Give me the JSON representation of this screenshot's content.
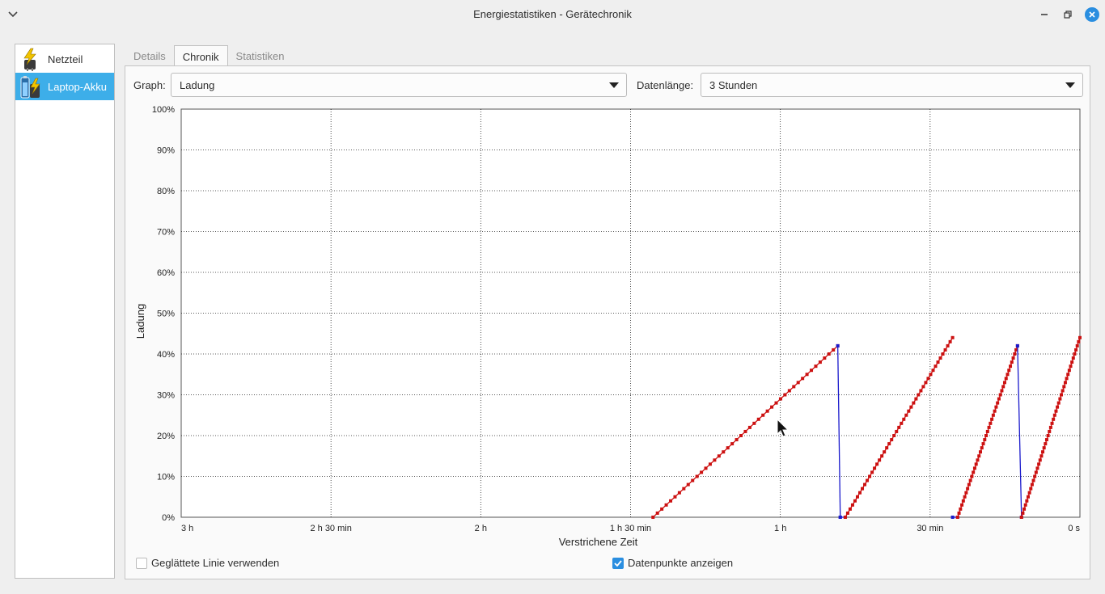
{
  "window": {
    "title": "Energiestatistiken - Gerätechronik",
    "menu_icon": "chevron-down-icon",
    "minimize_icon": "minimize-icon",
    "restore_icon": "restore-icon",
    "close_icon": "close-icon"
  },
  "sidebar": {
    "items": [
      {
        "label": "Netzteil",
        "icon": "power-supply-icon",
        "selected": false
      },
      {
        "label": "Laptop-Akku",
        "icon": "battery-icon",
        "selected": true
      }
    ]
  },
  "tabs": [
    {
      "label": "Details",
      "active": false
    },
    {
      "label": "Chronik",
      "active": true
    },
    {
      "label": "Statistiken",
      "active": false
    }
  ],
  "controls": {
    "graph_label": "Graph:",
    "graph_value": "Ladung",
    "length_label": "Datenlänge:",
    "length_value": "3 Stunden"
  },
  "options": {
    "smooth_label": "Geglättete Linie verwenden",
    "smooth_checked": false,
    "points_label": "Datenpunkte anzeigen",
    "points_checked": true
  },
  "chart_data": {
    "type": "line",
    "xlabel": "Verstrichene Zeit",
    "ylabel": "Ladung",
    "x_unit": "minutes elapsed",
    "xlim": [
      180,
      0
    ],
    "ylim": [
      0,
      100
    ],
    "x_tick_labels": [
      "3 h",
      "2 h 30 min",
      "2 h",
      "1 h 30 min",
      "1 h",
      "30 min",
      "0 s"
    ],
    "y_tick_labels": [
      "100%",
      "90%",
      "80%",
      "70%",
      "60%",
      "50%",
      "40%",
      "30%",
      "20%",
      "10%",
      "0%"
    ],
    "grid": true,
    "colors": {
      "charging": "#cc1111",
      "discharging": "#1a1acc"
    },
    "segments": [
      {
        "state": "charging",
        "x": [
          85.5,
          48.5
        ],
        "y": [
          0,
          42
        ]
      },
      {
        "state": "discharging",
        "x": [
          48.5,
          48.0
        ],
        "y": [
          42,
          0
        ]
      },
      {
        "state": "discharging",
        "x": [
          48.0,
          47.0
        ],
        "y": [
          0,
          0
        ]
      },
      {
        "state": "charging",
        "x": [
          47.0,
          25.5
        ],
        "y": [
          0,
          44
        ]
      },
      {
        "state": "discharging",
        "x": [
          25.5,
          24.5
        ],
        "y": [
          0,
          0
        ]
      },
      {
        "state": "charging",
        "x": [
          24.5,
          12.5
        ],
        "y": [
          0,
          42
        ]
      },
      {
        "state": "discharging",
        "x": [
          12.5,
          11.7
        ],
        "y": [
          42,
          0
        ]
      },
      {
        "state": "charging",
        "x": [
          11.7,
          0.0
        ],
        "y": [
          0,
          44
        ]
      }
    ]
  }
}
